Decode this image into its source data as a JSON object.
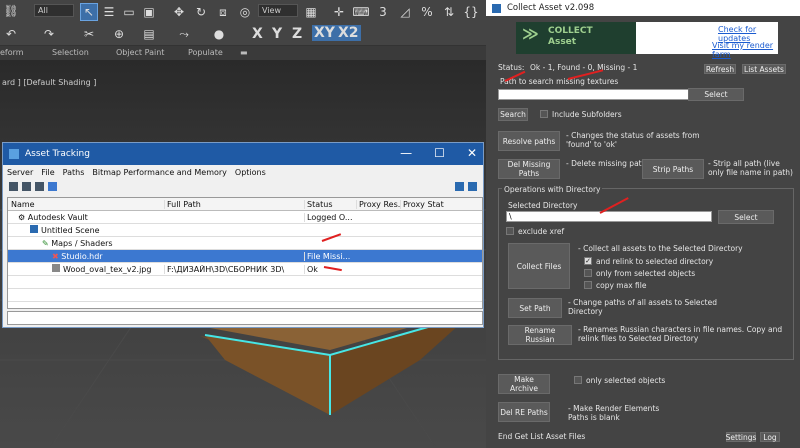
{
  "max": {
    "filter_dropdown": "All",
    "view_dropdown": "View",
    "axes": [
      "X",
      "Y",
      "Z",
      "XY",
      "X2"
    ],
    "ribbon": [
      "eform",
      "Selection",
      "Object Paint",
      "Populate"
    ],
    "viewport_label": "ard ] [Default Shading ]"
  },
  "asset_tracking": {
    "title": "Asset Tracking",
    "menu": [
      "Server",
      "File",
      "Paths",
      "Bitmap Performance and Memory",
      "Options"
    ],
    "columns": [
      "Name",
      "Full Path",
      "Status",
      "Proxy Res...",
      "Proxy Stat..."
    ],
    "rows": [
      {
        "name": "Autodesk Vault",
        "path": "",
        "status": "Logged O..."
      },
      {
        "name": "Untitled Scene",
        "path": "",
        "status": ""
      },
      {
        "name": "Maps / Shaders",
        "path": "",
        "status": ""
      },
      {
        "name": "Studio.hdr",
        "path": "",
        "status": "File Missi..."
      },
      {
        "name": "Wood_oval_tex_v2.jpg",
        "path": "F:\\ДИЗАЙН\\3D\\СБОРНИК 3D\\",
        "status": "Ok"
      }
    ]
  },
  "collect": {
    "title": "Collect Asset v2.098",
    "logo_line1": "COLLECT",
    "logo_line2": "Asset",
    "link_updates": "Check for updates",
    "link_farm": "Visit my render farm",
    "status_label": "Status:",
    "status_value": "Ok - 1, Found - 0, Missing - 1",
    "refresh": "Refresh",
    "list_assets": "List Assets",
    "path_label": "Path to search missing textures",
    "select": "Select",
    "search": "Search",
    "include_sub": "Include Subfolders",
    "resolve": "Resolve paths",
    "resolve_desc": "- Changes the status of assets from 'found' to 'ok'",
    "del_missing": "Del Missing Paths",
    "del_missing_desc": "- Delete missing paths",
    "strip": "Strip Paths",
    "strip_desc": "- Strip all path (live only file name in path)",
    "ops_title": "Operations with Directory",
    "sel_dir_label": "Selected Directory",
    "sel_dir_value": "\\",
    "select2": "Select",
    "exclude_xref": "exclude xref",
    "collect_files": "Collect Files",
    "collect_desc": "- Collect all assets to the Selected Directory",
    "opt_relink": "and relink to selected directory",
    "opt_only": "only from selected objects",
    "opt_copy": "copy max file",
    "set_path": "Set Path",
    "set_path_desc": "- Change paths of all assets to Selected Directory",
    "rename": "Rename Russian",
    "rename_desc": "- Renames Russian characters in file names. Copy and relink files to Selected Directory",
    "make_archive": "Make Archive",
    "only_sel": "only selected objects",
    "del_re": "Del RE Paths",
    "del_re_desc": "- Make Render Elements Paths is blank",
    "footer": "End Get List Asset Files",
    "settings": "Settings",
    "log": "Log"
  },
  "colors": {
    "accent": "#e02020",
    "title_blue": "#1f5aa5",
    "selection": "#3c78d0"
  }
}
